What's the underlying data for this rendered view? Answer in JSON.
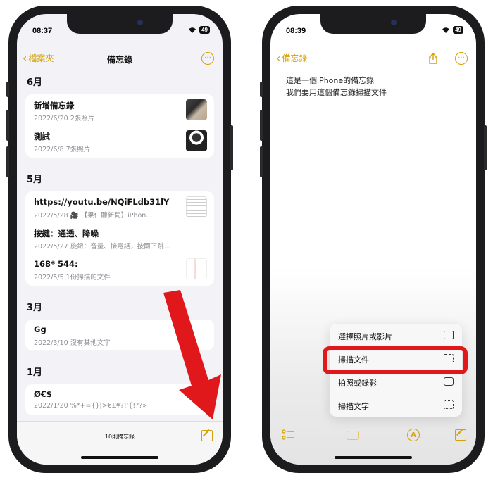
{
  "phone1": {
    "status": {
      "time": "08:37",
      "battery": "49"
    },
    "nav": {
      "back_label": "檔案夾",
      "title": "備忘錄",
      "more_icon": "ellipsis-circle-icon"
    },
    "sections": [
      {
        "header": "6月",
        "notes": [
          {
            "title": "新增備忘錄",
            "subtitle": "2022/6/20  2張照片",
            "thumb": "backpack-photo"
          },
          {
            "title": "測試",
            "subtitle": "2022/6/8  7張照片",
            "thumb": "person-photo"
          }
        ]
      },
      {
        "header": "5月",
        "notes": [
          {
            "title": "https://youtu.be/NQiFLdb31lY",
            "subtitle": "2022/5/28  🎥 【果仁聽新聞】iPhon...",
            "thumb": "document-photo"
          },
          {
            "title": "按鍵：通透、降噪",
            "subtitle": "2022/5/27  旋鈕：音量、接電話，按兩下跳...",
            "thumb": ""
          },
          {
            "title": "168* 544:",
            "subtitle": "2022/5/5  1份掃描的文件",
            "thumb": "scan-photo"
          }
        ]
      },
      {
        "header": "3月",
        "notes": [
          {
            "title": "Gg",
            "subtitle": "2022/3/10  沒有其他文字",
            "thumb": ""
          }
        ]
      },
      {
        "header": "1月",
        "notes": [
          {
            "title": "Ø€$",
            "subtitle": "2022/1/20  %*+={}|>€£¥?!'{!??»",
            "thumb": ""
          }
        ]
      }
    ],
    "footer": {
      "count": "10則備忘錄"
    }
  },
  "phone2": {
    "status": {
      "time": "08:39",
      "battery": "49"
    },
    "nav": {
      "back_label": "備忘錄"
    },
    "body_lines": [
      "這是一個iPhone的備忘錄",
      "我們要用這個備忘錄掃描文件"
    ],
    "menu": [
      {
        "label": "選擇照片或影片",
        "icon": "photo-library-icon"
      },
      {
        "label": "掃描文件",
        "icon": "doc-scan-icon"
      },
      {
        "label": "拍照或錄影",
        "icon": "camera-icon"
      },
      {
        "label": "掃描文字",
        "icon": "text-scan-icon"
      }
    ]
  },
  "colors": {
    "accent": "#d4a106",
    "highlight": "#e0171b"
  }
}
